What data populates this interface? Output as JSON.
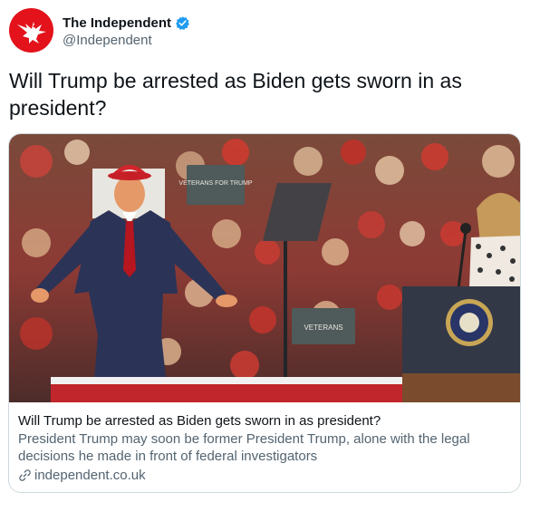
{
  "account": {
    "display_name": "The Independent",
    "handle": "@Independent",
    "avatar_icon": "eagle-logo-icon",
    "verified_icon": "verified-badge-icon",
    "brand_color": "#e3121b",
    "verified_color": "#1d9bf0"
  },
  "tweet": {
    "text": "Will Trump be arrested as Biden gets sworn in as president?"
  },
  "card": {
    "image_icon": "rally-photo",
    "sign_text_1": "VETERANS FOR TRUMP",
    "sign_text_2": "VETERANS",
    "title": "Will Trump be arrested as Biden gets sworn in as president?",
    "description": "President Trump may soon be former President Trump, alone with the legal decisions he made in front of federal investigators",
    "domain": "independent.co.uk",
    "domain_icon": "link-icon"
  }
}
